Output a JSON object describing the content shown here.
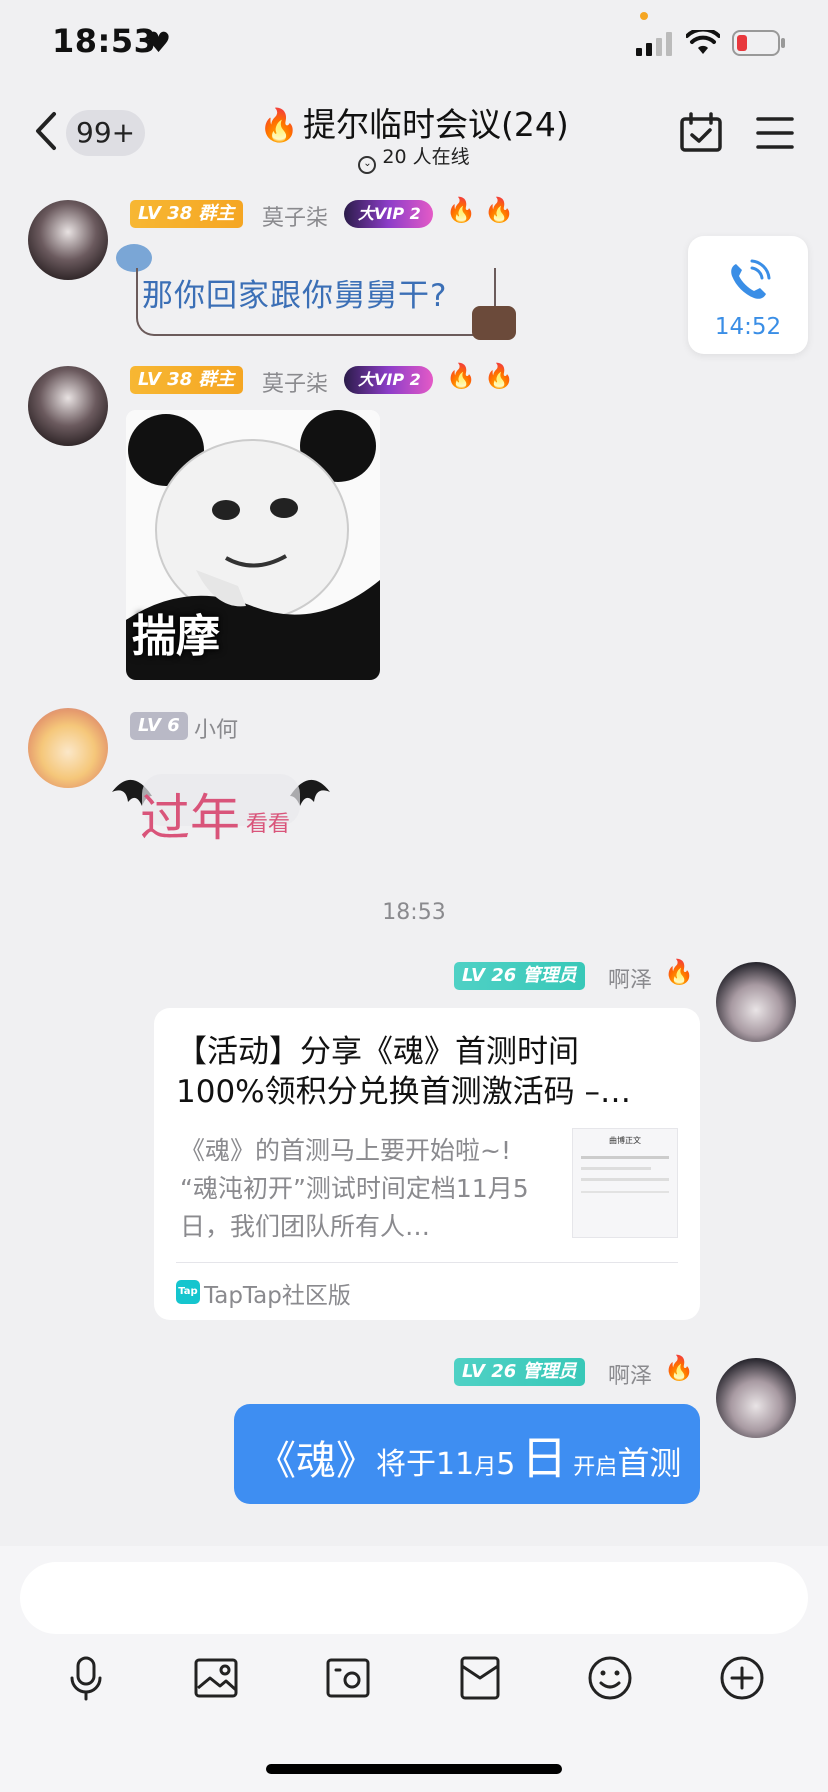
{
  "status_bar": {
    "time": "18:53"
  },
  "header": {
    "unread_badge": "99+",
    "title": "提尔临时会议(24)",
    "online_text": "20 人在线"
  },
  "messages": [
    {
      "level": "LV 38",
      "role": "群主",
      "name": "莫子柒",
      "vip": "大VIP 2",
      "text": "那你回家跟你舅舅干?"
    },
    {
      "level": "LV 38",
      "role": "群主",
      "name": "莫子柒",
      "vip": "大VIP 2",
      "sticker_caption": "揣摩"
    },
    {
      "level": "LV 6",
      "name": "小何",
      "text_large": "过年",
      "text_small": "看看"
    }
  ],
  "call_card": {
    "time": "14:52"
  },
  "timestamp": "18:53",
  "admin_messages": [
    {
      "level": "LV 26",
      "role": "管理员",
      "name": "啊泽",
      "card": {
        "title_line1": "【活动】分享《魂》首测时间",
        "title_line2": "100%领积分兑换首测激活码 –…",
        "desc_line1": "《魂》的首测马上要开始啦~!",
        "desc_line2": "“魂沌初开”测试时间定档11月5",
        "desc_line3": "日，我们团队所有人…",
        "thumb_title": "曲博正文",
        "source": "TapTap社区版",
        "source_icon_text": "Tap"
      }
    },
    {
      "level": "LV 26",
      "role": "管理员",
      "name": "啊泽",
      "bubble": {
        "p1": "《魂》",
        "p2": "将于11",
        "p3": "月",
        "p4": "5",
        "p5": "日",
        "p6": "开启",
        "p7": "首测"
      }
    }
  ],
  "colors": {
    "accent_blue": "#3e8ef2",
    "level_orange": "#f5a623",
    "level_teal": "#38c8b8",
    "link_blue": "#3b6fb6"
  }
}
